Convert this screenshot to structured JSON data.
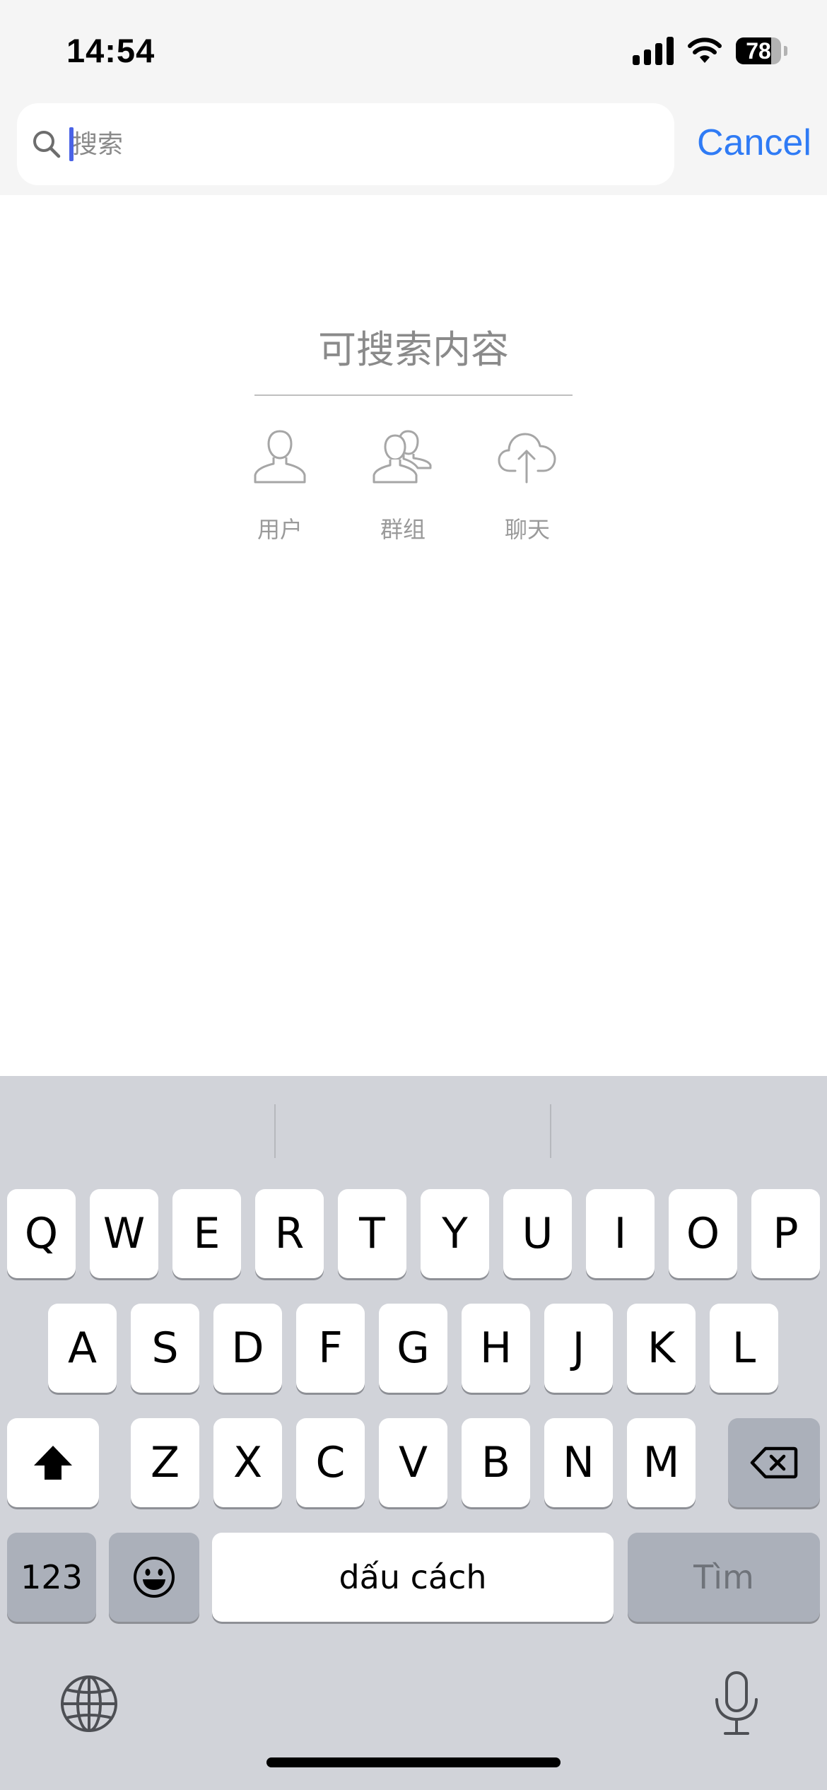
{
  "status_bar": {
    "time": "14:54",
    "battery": "78",
    "battery_level": 0.78
  },
  "search": {
    "placeholder": "搜索",
    "value": "",
    "cancel_label": "Cancel"
  },
  "searchable": {
    "title": "可搜索内容",
    "categories": [
      {
        "label": "用户",
        "icon": "user-icon"
      },
      {
        "label": "群组",
        "icon": "group-icon"
      },
      {
        "label": "聊天",
        "icon": "cloud-upload-icon"
      }
    ]
  },
  "keyboard": {
    "row1": [
      "Q",
      "W",
      "E",
      "R",
      "T",
      "Y",
      "U",
      "I",
      "O",
      "P"
    ],
    "row2": [
      "A",
      "S",
      "D",
      "F",
      "G",
      "H",
      "J",
      "K",
      "L"
    ],
    "row3": [
      "Z",
      "X",
      "C",
      "V",
      "B",
      "N",
      "M"
    ],
    "numbers_label": "123",
    "space_label": "dấu cách",
    "search_label": "Tìm",
    "icons": [
      "shift-icon",
      "backspace-icon",
      "emoji-icon",
      "globe-icon",
      "microphone-icon"
    ]
  }
}
